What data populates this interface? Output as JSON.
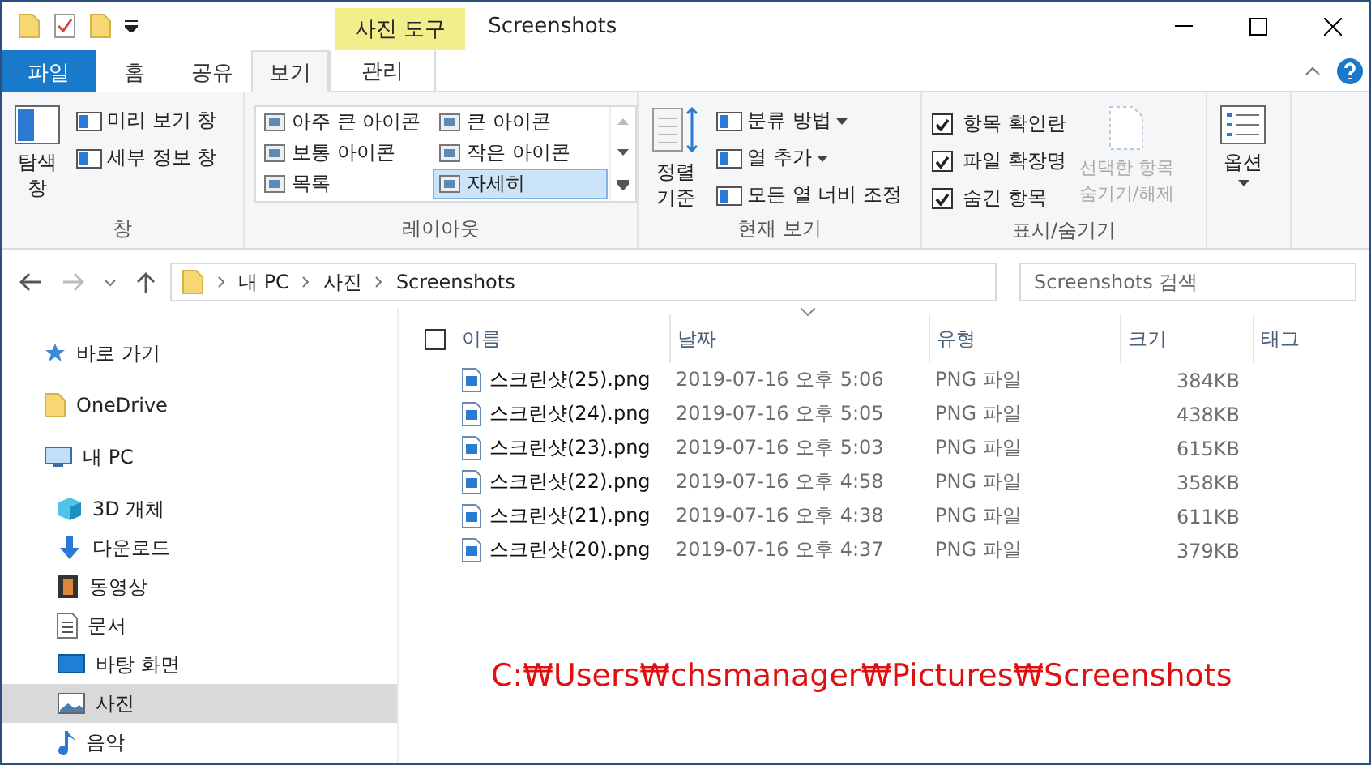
{
  "window": {
    "title": "Screenshots",
    "context_tab": "사진 도구"
  },
  "tabs": [
    {
      "label": "파일",
      "kind": "file",
      "selected": false
    },
    {
      "label": "홈",
      "kind": "tab",
      "selected": false
    },
    {
      "label": "공유",
      "kind": "tab",
      "selected": false
    },
    {
      "label": "보기",
      "kind": "tab",
      "selected": true
    },
    {
      "label": "관리",
      "kind": "context",
      "selected": false
    }
  ],
  "ribbon": {
    "pane": {
      "large": "탐색\n창",
      "small": [
        "미리 보기 창",
        "세부 정보 창"
      ],
      "group": "창"
    },
    "layout": {
      "items": [
        {
          "label": "아주 큰 아이콘",
          "selected": false
        },
        {
          "label": "큰 아이콘",
          "selected": false
        },
        {
          "label": "보통 아이콘",
          "selected": false
        },
        {
          "label": "작은 아이콘",
          "selected": false
        },
        {
          "label": "목록",
          "selected": false
        },
        {
          "label": "자세히",
          "selected": true
        }
      ],
      "group": "레이아웃"
    },
    "current_view": {
      "large": "정렬\n기준",
      "small": [
        "분류 방법",
        "열 추가",
        "모든 열 너비 조정"
      ],
      "group": "현재 보기"
    },
    "show_hide": {
      "checks": [
        {
          "label": "항목 확인란",
          "checked": true
        },
        {
          "label": "파일 확장명",
          "checked": true
        },
        {
          "label": "숨긴 항목",
          "checked": true
        }
      ],
      "hide_selected": {
        "label": "선택한 항목\n숨기기/해제",
        "disabled": true
      },
      "group": "표시/숨기기"
    },
    "options": {
      "label": "옵션"
    }
  },
  "address": {
    "crumbs": [
      "내 PC",
      "사진",
      "Screenshots"
    ],
    "search_placeholder": "Screenshots 검색"
  },
  "nav": [
    {
      "label": "바로 가기",
      "kind": "star",
      "selected": false
    },
    {
      "label": "OneDrive",
      "kind": "folder",
      "selected": false
    },
    {
      "label": "내 PC",
      "kind": "pc",
      "selected": false,
      "children": [
        {
          "label": "3D 개체",
          "kind": "cube",
          "selected": false
        },
        {
          "label": "다운로드",
          "kind": "download",
          "selected": false
        },
        {
          "label": "동영상",
          "kind": "video",
          "selected": false
        },
        {
          "label": "문서",
          "kind": "doc",
          "selected": false
        },
        {
          "label": "바탕 화면",
          "kind": "desktop",
          "selected": false
        },
        {
          "label": "사진",
          "kind": "picture",
          "selected": true
        },
        {
          "label": "음악",
          "kind": "music",
          "selected": false
        }
      ]
    }
  ],
  "table": {
    "select_all": {
      "checked": false
    },
    "columns": [
      {
        "label": "이름",
        "sorted": false
      },
      {
        "label": "날짜",
        "sorted": true
      },
      {
        "label": "유형",
        "sorted": false
      },
      {
        "label": "크기",
        "sorted": false
      },
      {
        "label": "태그",
        "sorted": false
      }
    ],
    "rows": [
      [
        "스크린샷(25).png",
        "2019-07-16 오후 5:06",
        "PNG 파일",
        "384KB"
      ],
      [
        "스크린샷(24).png",
        "2019-07-16 오후 5:05",
        "PNG 파일",
        "438KB"
      ],
      [
        "스크린샷(23).png",
        "2019-07-16 오후 5:03",
        "PNG 파일",
        "615KB"
      ],
      [
        "스크린샷(22).png",
        "2019-07-16 오후 4:58",
        "PNG 파일",
        "358KB"
      ],
      [
        "스크린샷(21).png",
        "2019-07-16 오후 4:38",
        "PNG 파일",
        "611KB"
      ],
      [
        "스크린샷(20).png",
        "2019-07-16 오후 4:37",
        "PNG 파일",
        "379KB"
      ]
    ]
  },
  "annotation": "C:₩Users₩chsmanager₩Pictures₩Screenshots"
}
